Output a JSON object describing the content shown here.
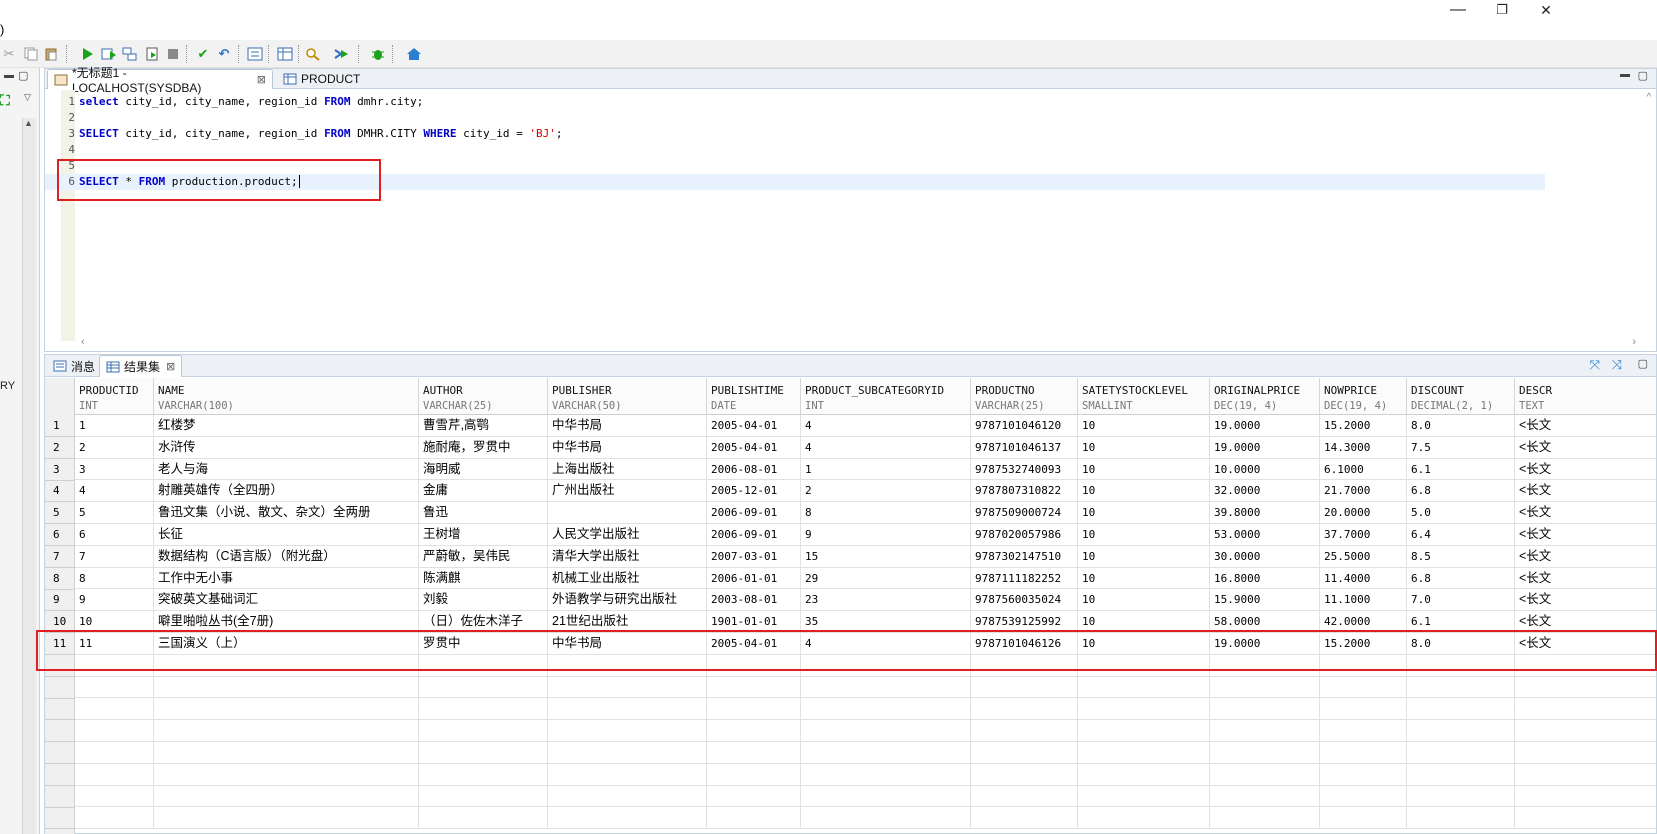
{
  "window": {
    "left_char": ")",
    "minimize": "—",
    "restore": "❐",
    "close": "✕"
  },
  "toolbar": {
    "icons": [
      "cut-icon",
      "copy-icon",
      "paste-icon",
      "run-icon",
      "run-selection-icon",
      "run-script-icon",
      "explain-icon",
      "stop-icon",
      "commit-icon",
      "rollback-icon",
      "format-icon",
      "table-icon",
      "find-icon",
      "step-icon",
      "debug-icon",
      "home-icon"
    ]
  },
  "left_panel": {
    "truncated_label": "RY"
  },
  "editor": {
    "tabs": [
      {
        "label": "*无标题1 - LOCALHOST(SYSDBA)",
        "active": true
      },
      {
        "label": "PRODUCT",
        "active": false
      }
    ],
    "lines": [
      {
        "n": "1",
        "segments": [
          [
            "kw",
            "select"
          ],
          [
            "t",
            " city_id, city_name, region_id "
          ],
          [
            "kw",
            "FROM"
          ],
          [
            "t",
            " dmhr.city;"
          ]
        ]
      },
      {
        "n": "2",
        "segments": []
      },
      {
        "n": "3",
        "segments": [
          [
            "kw",
            "SELECT"
          ],
          [
            "t",
            " city_id, city_name, region_id "
          ],
          [
            "kw",
            "FROM"
          ],
          [
            "t",
            " DMHR.CITY "
          ],
          [
            "kw",
            "WHERE"
          ],
          [
            "t",
            " city_id = "
          ],
          [
            "str",
            "'BJ'"
          ],
          [
            "t",
            ";"
          ]
        ]
      },
      {
        "n": "4",
        "segments": []
      },
      {
        "n": "5",
        "segments": []
      },
      {
        "n": "6",
        "segments": [
          [
            "kw",
            "SELECT"
          ],
          [
            "t",
            " * "
          ],
          [
            "kw",
            "FROM"
          ],
          [
            "t",
            " production.product;"
          ]
        ]
      }
    ]
  },
  "results": {
    "tabs": [
      {
        "label": "消息",
        "active": false
      },
      {
        "label": "结果集",
        "active": true
      }
    ],
    "columns": [
      {
        "name": "PRODUCTID",
        "type": "INT"
      },
      {
        "name": "NAME",
        "type": "VARCHAR(100)"
      },
      {
        "name": "AUTHOR",
        "type": "VARCHAR(25)"
      },
      {
        "name": "PUBLISHER",
        "type": "VARCHAR(50)"
      },
      {
        "name": "PUBLISHTIME",
        "type": "DATE"
      },
      {
        "name": "PRODUCT_SUBCATEGORYID",
        "type": "INT"
      },
      {
        "name": "PRODUCTNO",
        "type": "VARCHAR(25)"
      },
      {
        "name": "SATETYSTOCKLEVEL",
        "type": "SMALLINT"
      },
      {
        "name": "ORIGINALPRICE",
        "type": "DEC(19, 4)"
      },
      {
        "name": "NOWPRICE",
        "type": "DEC(19, 4)"
      },
      {
        "name": "DISCOUNT",
        "type": "DECIMAL(2, 1)"
      },
      {
        "name": "DESCR",
        "type": "TEXT"
      }
    ],
    "rows": [
      [
        "1",
        "红楼梦",
        "曹雪芹,高鹗",
        "中华书局",
        "2005-04-01",
        "4",
        "9787101046120",
        "10",
        "19.0000",
        "15.2000",
        "8.0",
        "<长文"
      ],
      [
        "2",
        "水浒传",
        "施耐庵，罗贯中",
        "中华书局",
        "2005-04-01",
        "4",
        "9787101046137",
        "10",
        "19.0000",
        "14.3000",
        "7.5",
        "<长文"
      ],
      [
        "3",
        "老人与海",
        "海明威",
        "上海出版社",
        "2006-08-01",
        "1",
        "9787532740093",
        "10",
        "10.0000",
        "6.1000",
        "6.1",
        "<长文"
      ],
      [
        "4",
        "射雕英雄传（全四册）",
        "金庸",
        "广州出版社",
        "2005-12-01",
        "2",
        "9787807310822",
        "10",
        "32.0000",
        "21.7000",
        "6.8",
        "<长文"
      ],
      [
        "5",
        "鲁迅文集（小说、散文、杂文）全两册",
        "鲁迅",
        "",
        "2006-09-01",
        "8",
        "9787509000724",
        "10",
        "39.8000",
        "20.0000",
        "5.0",
        "<长文"
      ],
      [
        "6",
        "长征",
        "王树增",
        "人民文学出版社",
        "2006-09-01",
        "9",
        "9787020057986",
        "10",
        "53.0000",
        "37.7000",
        "6.4",
        "<长文"
      ],
      [
        "7",
        "数据结构（C语言版）（附光盘）",
        "严蔚敏，吴伟民",
        "清华大学出版社",
        "2007-03-01",
        "15",
        "9787302147510",
        "10",
        "30.0000",
        "25.5000",
        "8.5",
        "<长文"
      ],
      [
        "8",
        "工作中无小事",
        "陈满麒",
        "机械工业出版社",
        "2006-01-01",
        "29",
        "9787111182252",
        "10",
        "16.8000",
        "11.4000",
        "6.8",
        "<长文"
      ],
      [
        "9",
        "突破英文基础词汇",
        "刘毅",
        "外语教学与研究出版社",
        "2003-08-01",
        "23",
        "9787560035024",
        "10",
        "15.9000",
        "11.1000",
        "7.0",
        "<长文"
      ],
      [
        "10",
        "噼里啪啦丛书(全7册)",
        "（日）佐佐木洋子",
        "21世纪出版社",
        "1901-01-01",
        "35",
        "9787539125992",
        "10",
        "58.0000",
        "42.0000",
        "6.1",
        "<长文"
      ],
      [
        "11",
        "三国演义（上）",
        "罗贯中",
        "中华书局",
        "2005-04-01",
        "4",
        "9787101046126",
        "10",
        "19.0000",
        "15.2000",
        "8.0",
        "<长文"
      ]
    ]
  },
  "colors": {
    "highlight_red": "#e02020",
    "keyword": "#0000c8",
    "string": "#d20000",
    "current_line": "#e8f2fe"
  }
}
